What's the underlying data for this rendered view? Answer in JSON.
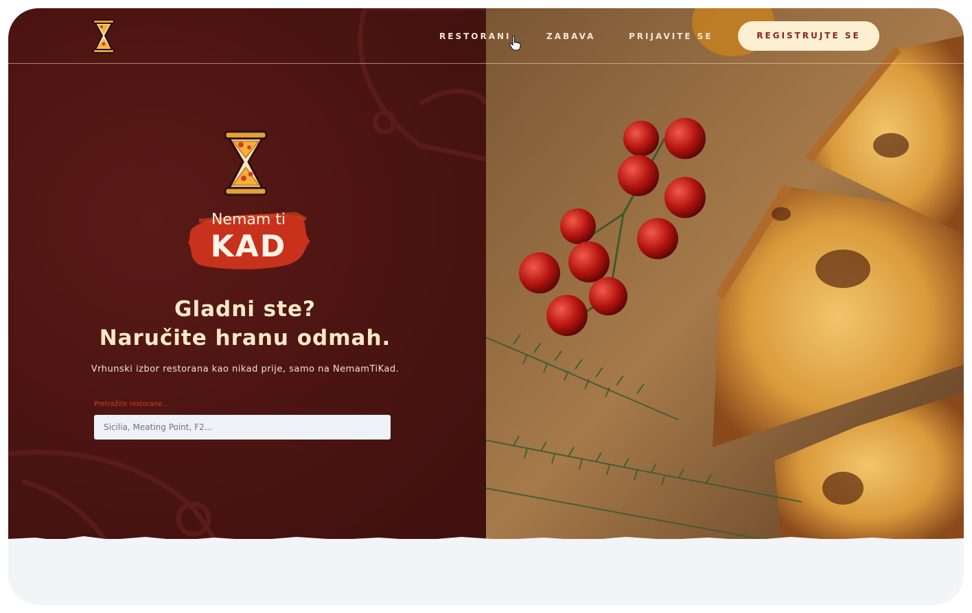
{
  "nav": {
    "items": [
      "RESTORANI",
      "ZABAVA",
      "PRIJAVITE SE"
    ],
    "register_label": "REGISTRUJTE SE"
  },
  "brand": {
    "small": "Nemam ti",
    "big": "KAD"
  },
  "hero": {
    "headline_line1": "Gladni ste?",
    "headline_line2": "Naručite hranu odmah.",
    "subline": "Vrhunski izbor restorana kao nikad prije, samo na NemamTiKad.",
    "search_label": "Pretražite restorane...",
    "search_placeholder": "Sicilia, Meating Point, F2..."
  },
  "colors": {
    "left_bg": "#4a1411",
    "accent": "#d83b24",
    "cream": "#fdefd2"
  },
  "icons": {
    "logo": "pizza-hourglass-icon",
    "cursor": "hand-pointer-icon"
  }
}
